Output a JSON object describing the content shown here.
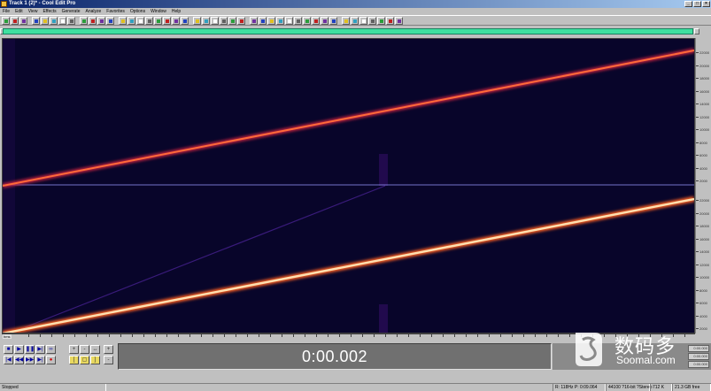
{
  "window": {
    "title": "Track 1 (2)* - Cool Edit Pro",
    "controls": [
      "_",
      "□",
      "×"
    ]
  },
  "menu": [
    "File",
    "Edit",
    "View",
    "Effects",
    "Generate",
    "Analyze",
    "Favorites",
    "Options",
    "Window",
    "Help"
  ],
  "toolbar": {
    "icons": [
      "new-file",
      "open-file",
      "save-file",
      "cut",
      "copy",
      "paste",
      "paste-new",
      "mix-paste",
      "undo",
      "redo",
      "repeat-last",
      "settings",
      "waveform-view",
      "spectral-view",
      "spectral-pan",
      "loop-play",
      "play-to-end",
      "metronome",
      "cd-player",
      "scripts",
      "frequency-analysis",
      "phase-analysis",
      "statistics",
      "marker-list",
      "cue-list",
      "playlist",
      "noise-reduction",
      "click-eliminator",
      "amplify",
      "envelope",
      "equalizer",
      "delay",
      "reverb",
      "filter",
      "pitch-bend",
      "stretch",
      "mute",
      "silence",
      "normalize",
      "invert",
      "reverse",
      "dynamics",
      "hiss-reduction"
    ],
    "colors": {
      "green": "#2a9d3a",
      "red": "#c02020",
      "purple": "#7030a0",
      "blue": "#2040c0",
      "yellow": "#e0c020"
    }
  },
  "overview": {
    "color": "#3fe0a0"
  },
  "spectral": {
    "background": "#08052a",
    "sweep_color_top": "#ff5a30",
    "sweep_color_bottom": "#ffd090",
    "frequency_labels_top": [
      "- 22000",
      "- 20000",
      "- 18000",
      "- 16000",
      "- 14000",
      "- 12000",
      "- 10000",
      "- 8000",
      "- 6000",
      "- 4000",
      "- 2000"
    ],
    "frequency_labels_bottom": [
      "- 22000",
      "- 20000",
      "- 18000",
      "- 16000",
      "- 14000",
      "- 12000",
      "- 10000",
      "- 8000",
      "- 6000",
      "- 4000",
      "- 2000"
    ]
  },
  "time_ruler": {
    "format": "hms"
  },
  "transport": {
    "stop": "■",
    "play": "▶",
    "pause": "❚❚",
    "play_to_end": "▶|",
    "loop": "∞",
    "go_start": "|◀",
    "rewind": "◀◀",
    "forward": "▶▶",
    "go_end": "▶|",
    "record": "●"
  },
  "zoom": {
    "zoom_in_h": "+",
    "zoom_out_h": "-",
    "zoom_full_h": "↔",
    "zoom_in_v": "+",
    "zoom_out_v": "-",
    "zoom_sel": "▢",
    "zoom_left": "[",
    "zoom_right": "]",
    "zoom_full_v": "↕",
    "zoom_full_v2": "⇕"
  },
  "time_display": "0:00.002",
  "selection": {
    "begin": "0:00.000",
    "end": "0:00.000",
    "length": "0:00.000"
  },
  "statusbar": {
    "status": "Stopped",
    "cursor": "R: 118Hz  P: 0:09.064",
    "format": "44100 ?16-bit ?Stereo",
    "size": "712 K",
    "free": "21.3 GB free"
  },
  "watermark": {
    "chinese": "数码多",
    "url": "Soomal.com"
  }
}
